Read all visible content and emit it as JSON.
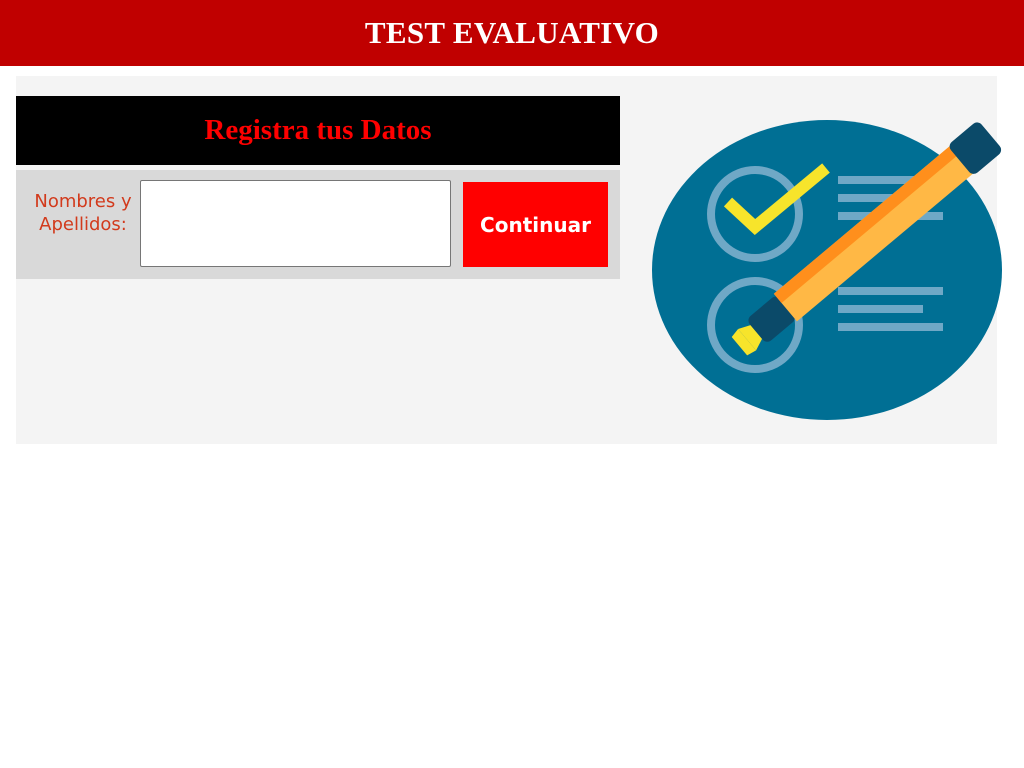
{
  "header": {
    "title": "TEST EVALUATIVO",
    "color": "#c00000"
  },
  "form": {
    "title": "Registra tus Datos",
    "title_color": "#ff0000",
    "field_label": "Nombres y Apellidos:",
    "field_value": "",
    "field_placeholder": "",
    "continue_label": "Continuar",
    "button_color": "#ff0000"
  },
  "illustration": {
    "icon": "checklist-with-pencil-icon",
    "circle_color": "#006f94",
    "check_color": "#f7e42b",
    "pencil_color": "#ffb845"
  }
}
